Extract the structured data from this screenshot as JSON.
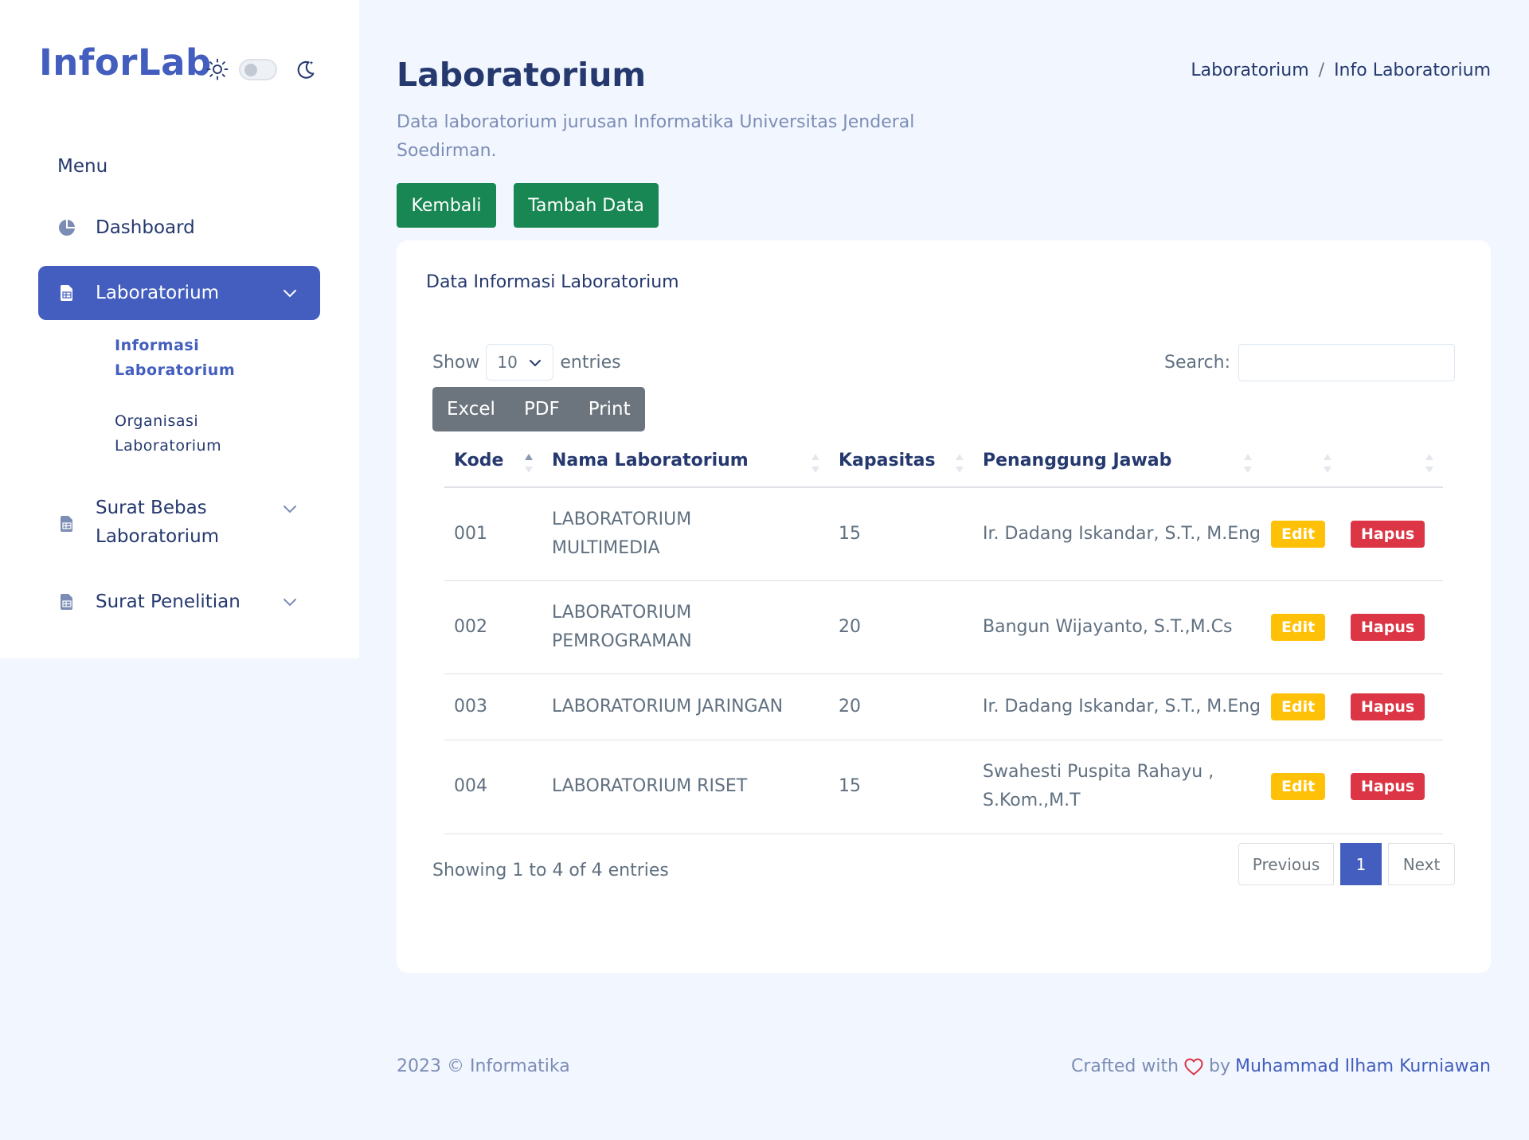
{
  "sidebar": {
    "logo": "InforLab",
    "menu_title": "Menu",
    "items": [
      {
        "label": "Dashboard"
      },
      {
        "label": "Laboratorium"
      },
      {
        "label": "Surat Bebas Laboratorium"
      },
      {
        "label": "Surat Penelitian"
      }
    ],
    "submenu": [
      {
        "label": "Informasi Laboratorium"
      },
      {
        "label": "Organisasi Laboratorium"
      }
    ]
  },
  "header": {
    "title": "Laboratorium",
    "subtitle": "Data laboratorium jurusan Informatika Universitas Jenderal Soedirman.",
    "breadcrumb": [
      "Laboratorium",
      "Info Laboratorium"
    ],
    "breadcrumb_sep": "/"
  },
  "actions": {
    "back_label": "Kembali",
    "add_label": "Tambah Data"
  },
  "card": {
    "title": "Data Informasi Laboratorium",
    "show_label": "Show",
    "entries_value": "10",
    "entries_label": "entries",
    "search_label": "Search:",
    "export_buttons": [
      "Excel",
      "PDF",
      "Print"
    ],
    "columns": [
      "Kode",
      "Nama Laboratorium",
      "Kapasitas",
      "Penanggung Jawab",
      "",
      ""
    ],
    "rows": [
      {
        "kode": "001",
        "nama": "LABORATORIUM MULTIMEDIA",
        "kapasitas": "15",
        "pj": "Ir. Dadang Iskandar, S.T., M.Eng",
        "edit": "Edit",
        "hapus": "Hapus"
      },
      {
        "kode": "002",
        "nama": "LABORATORIUM PEMROGRAMAN",
        "kapasitas": "20",
        "pj": "Bangun Wijayanto, S.T.,M.Cs",
        "edit": "Edit",
        "hapus": "Hapus"
      },
      {
        "kode": "003",
        "nama": "LABORATORIUM JARINGAN",
        "kapasitas": "20",
        "pj": "Ir. Dadang Iskandar, S.T., M.Eng",
        "edit": "Edit",
        "hapus": "Hapus"
      },
      {
        "kode": "004",
        "nama": "LABORATORIUM RISET",
        "kapasitas": "15",
        "pj": "Swahesti Puspita Rahayu , S.Kom.,M.T",
        "edit": "Edit",
        "hapus": "Hapus"
      }
    ],
    "info": "Showing 1 to 4 of 4 entries",
    "pagination": {
      "prev": "Previous",
      "current": "1",
      "next": "Next"
    }
  },
  "footer": {
    "copyright": "2023 © Informatika",
    "crafted_with": "Crafted with",
    "by": "by",
    "author": "Muhammad Ilham Kurniawan"
  },
  "colors": {
    "primary": "#435ebe",
    "success": "#198754",
    "warning": "#ffc107",
    "danger": "#dc3545",
    "secondary": "#6c757d",
    "background": "#f2f7ff"
  }
}
